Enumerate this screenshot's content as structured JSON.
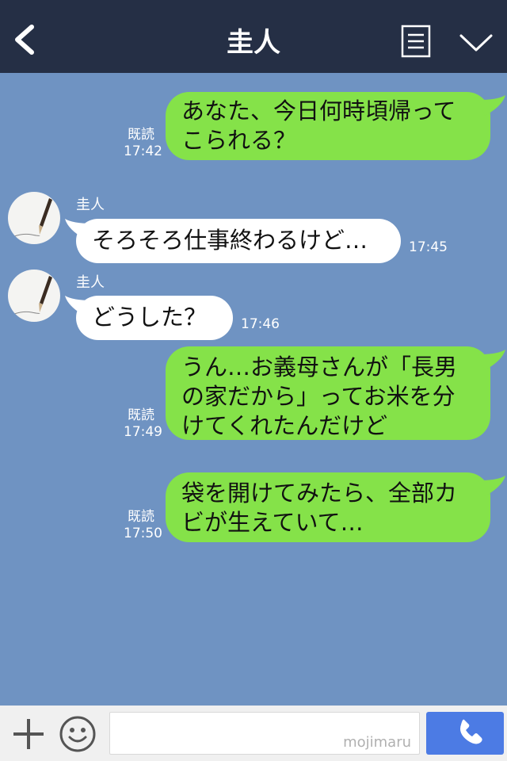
{
  "header": {
    "title": "圭人",
    "back_icon": "chevron-left-icon",
    "menu_icon": "note-list-icon",
    "collapse_icon": "chevron-down-icon",
    "background": "#252f45"
  },
  "chat": {
    "background": "#6f93c2",
    "messages": [
      {
        "side": "right",
        "text": "あなた、今日何時頃帰って\nこられる？",
        "read": "既読",
        "time": "17:42"
      },
      {
        "side": "left",
        "sender": "圭人",
        "text": "そろそろ仕事終わるけど…",
        "time": "17:45"
      },
      {
        "side": "left",
        "sender": "圭人",
        "text": "どうした？",
        "time": "17:46"
      },
      {
        "side": "right",
        "text": "うん…お義母さんが「長男\nの家だから」ってお米を分\nけてくれたんだけど",
        "read": "既読",
        "time": "17:49"
      },
      {
        "side": "right",
        "text": "袋を開けてみたら、全部カ\nビが生えていて…",
        "read": "既読",
        "time": "17:50"
      }
    ]
  },
  "footer": {
    "plus_icon": "plus-icon",
    "emoji_icon": "smiley-icon",
    "input_value": "",
    "watermark": "mojimaru",
    "call_icon": "phone-icon",
    "call_color": "#4c7be4"
  },
  "colors": {
    "my_bubble": "#85e249",
    "their_bubble": "#ffffff"
  }
}
